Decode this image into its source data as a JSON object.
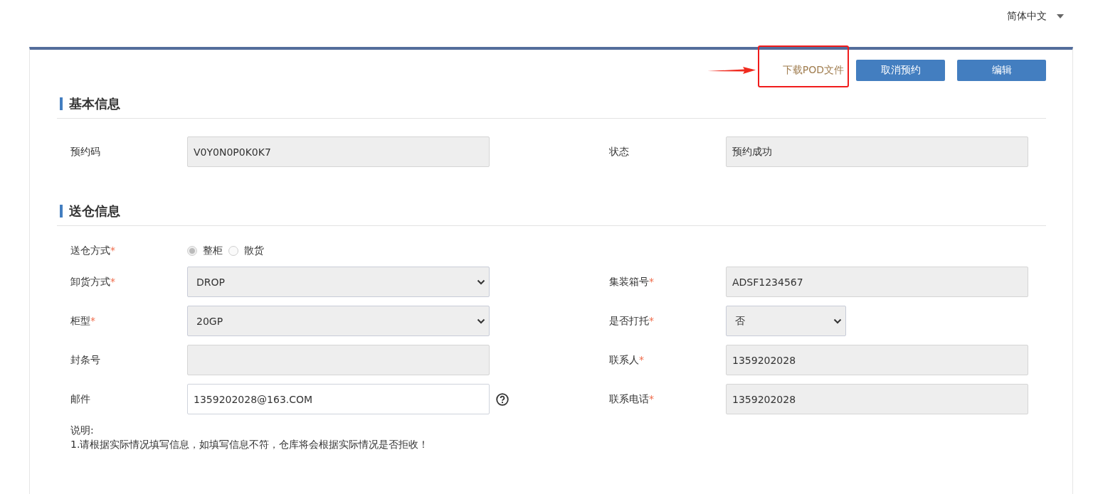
{
  "language": {
    "label": "简体中文"
  },
  "actions": [
    {
      "kind": "link",
      "label": "下载POD文件",
      "highlighted": true
    },
    {
      "kind": "button",
      "label": "取消预约"
    },
    {
      "kind": "button",
      "label": "编辑"
    }
  ],
  "sections": [
    {
      "title": "基本信息",
      "rows": [
        [
          {
            "kind": "text",
            "label": "预约码",
            "value": "V0Y0N0P0K0K7",
            "disabled": true
          },
          {
            "kind": "text",
            "label": "状态",
            "value": "预约成功",
            "disabled": true
          }
        ]
      ]
    },
    {
      "title": "送仓信息",
      "rows": [
        [
          {
            "kind": "radio",
            "label": "送仓方式",
            "required_mark": "*",
            "options": [
              {
                "label": "整柜",
                "selected": true
              },
              {
                "label": "散货",
                "selected": false
              }
            ],
            "disabled": true
          }
        ],
        [
          {
            "kind": "select",
            "label": "卸货方式",
            "required_mark": "*",
            "value": "DROP",
            "disabled": true
          },
          {
            "kind": "text",
            "label": "集装箱号",
            "required_mark": "*",
            "value": "ADSF1234567",
            "disabled": true
          }
        ],
        [
          {
            "kind": "select",
            "label": "柜型",
            "required_mark": "*",
            "value": "20GP",
            "disabled": true
          },
          {
            "kind": "select_small",
            "label": "是否打托",
            "required_mark": "*",
            "value": "否",
            "disabled": true
          }
        ],
        [
          {
            "kind": "text",
            "label": "封条号",
            "disabled": true
          },
          {
            "kind": "text",
            "label": "联系人",
            "required_mark": "*",
            "value": "1359202028",
            "disabled": true
          }
        ],
        [
          {
            "kind": "text",
            "label": "邮件",
            "value": "1359202028@163.COM",
            "disabled": false,
            "help": true
          },
          {
            "kind": "text",
            "label": "联系电话",
            "required_mark": "*",
            "value": "1359202028",
            "disabled": true
          }
        ]
      ]
    }
  ],
  "notes": {
    "title": "说明:",
    "lines": [
      "1.请根据实际情况填写信息，如填写信息不符，仓库将会根据实际情况是否拒收！"
    ]
  }
}
